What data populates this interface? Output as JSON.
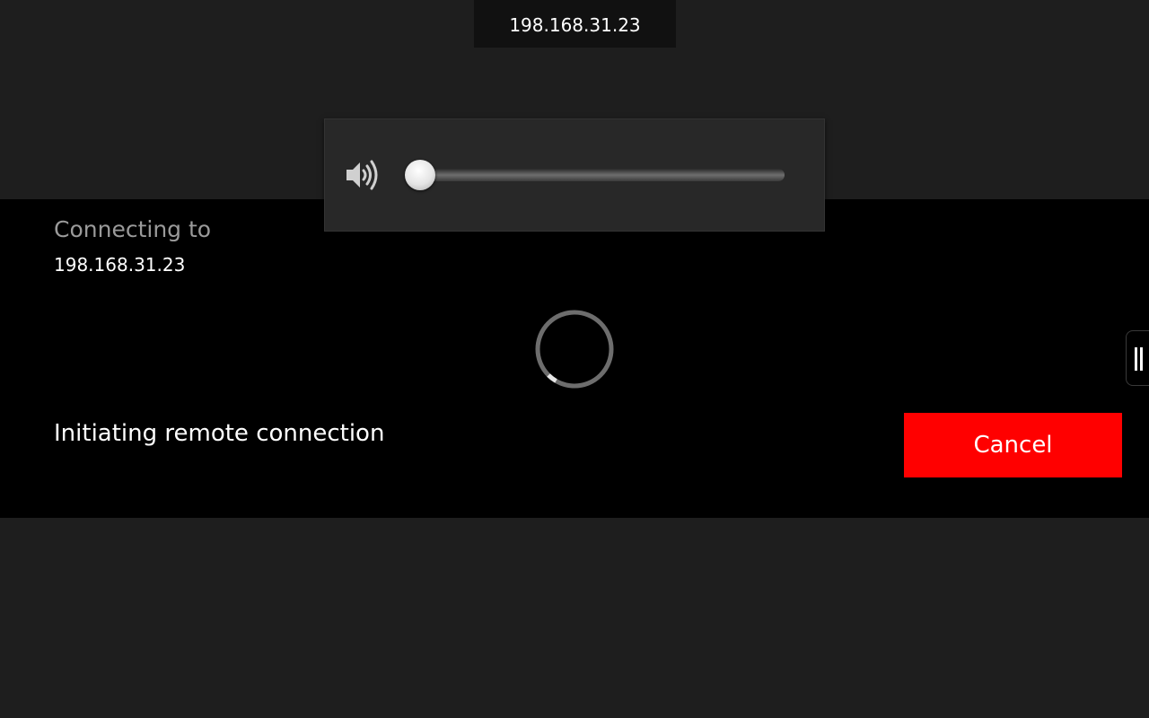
{
  "top_tab": {
    "host": "198.168.31.23"
  },
  "dialog": {
    "title": "Connecting to",
    "host": "198.168.31.23",
    "status": "Initiating remote connection",
    "cancel_label": "Cancel"
  },
  "volume": {
    "level": 0.0,
    "icon": "speaker-volume-icon"
  },
  "spinner": {
    "icon": "loading-spinner-icon"
  },
  "side_handle": {
    "icon": "pause-bars-icon"
  },
  "colors": {
    "background": "#1e1e1e",
    "dialog": "#000000",
    "cancel": "#ff0000",
    "muted_text": "#9a9a9a"
  }
}
